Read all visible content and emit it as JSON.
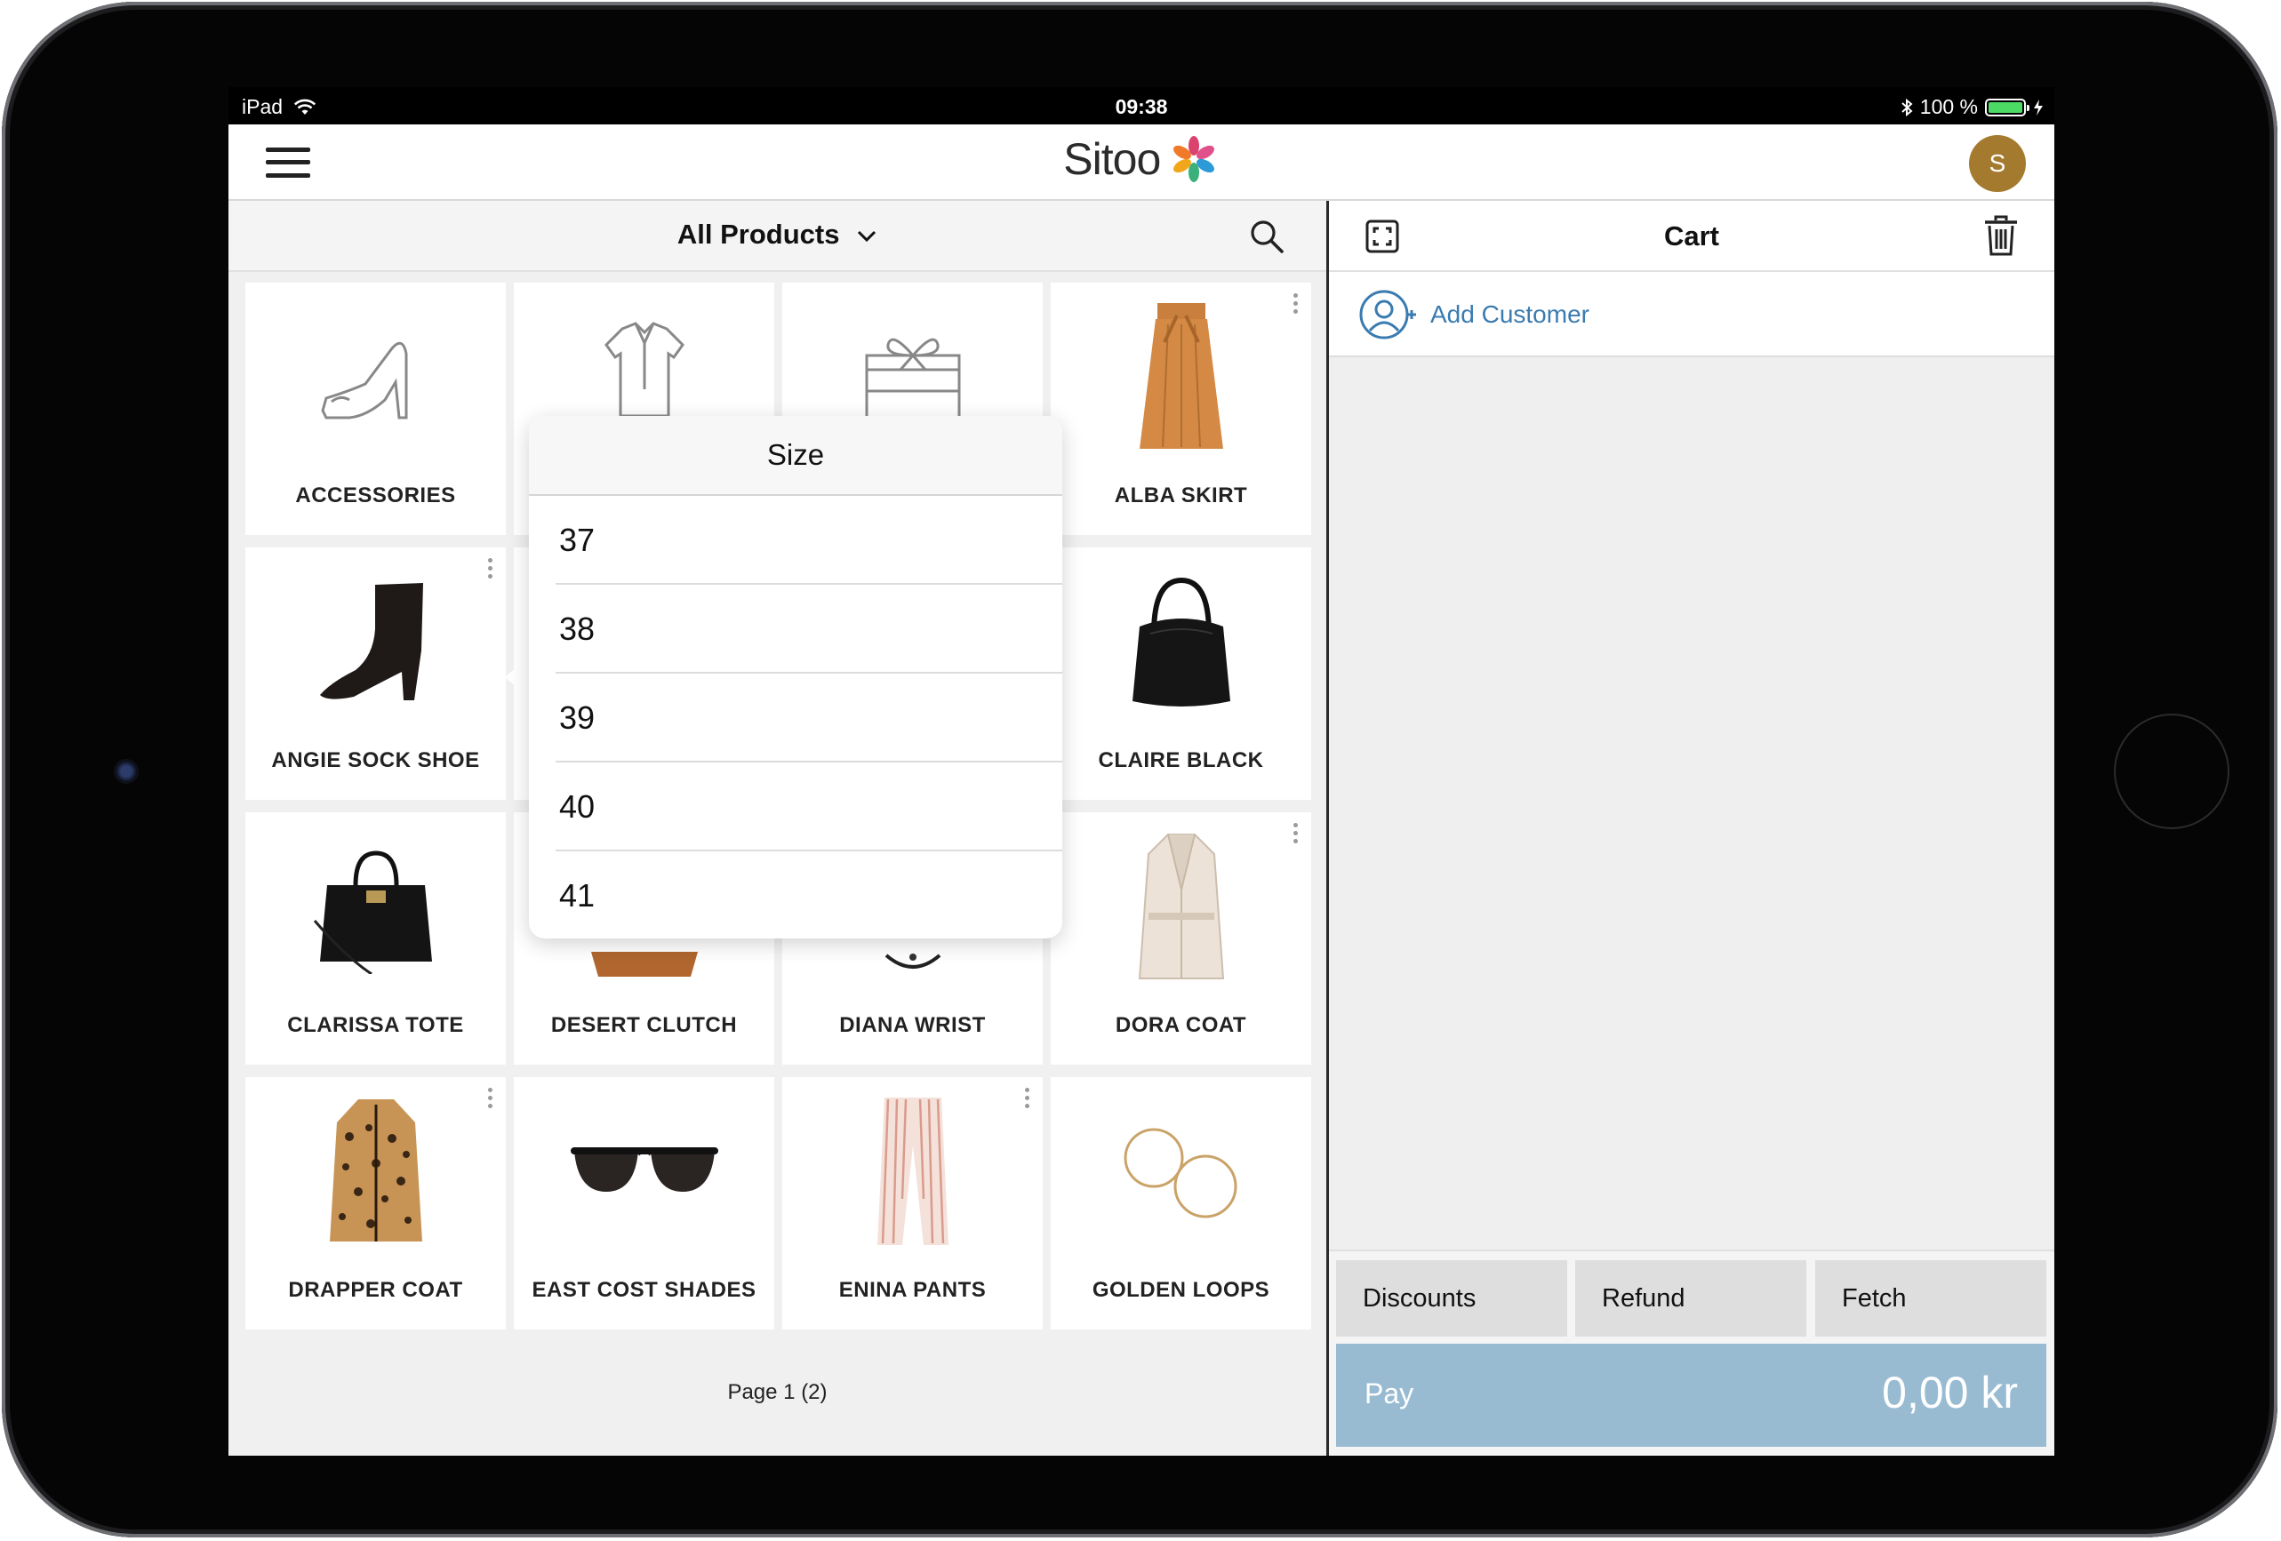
{
  "statusbar": {
    "device": "iPad",
    "time": "09:38",
    "battery": "100 %",
    "battery_level": 1.0
  },
  "topnav": {
    "logo_text": "Sitoo",
    "avatar_initial": "S",
    "avatar_color": "#a47a2f"
  },
  "products": {
    "category_label": "All Products",
    "tiles": [
      {
        "label": "ACCESSORIES",
        "icon": "shoe-icon"
      },
      {
        "label": "",
        "icon": "shirt-icon"
      },
      {
        "label": "",
        "icon": "gift-icon"
      },
      {
        "label": "ALBA SKIRT",
        "icon": "skirt-icon"
      },
      {
        "label": "ANGIE SOCK SHOE",
        "icon": "boot-icon"
      },
      {
        "label": "",
        "icon": ""
      },
      {
        "label": "",
        "icon": ""
      },
      {
        "label": "CLAIRE BLACK",
        "icon": "handbag-icon"
      },
      {
        "label": "CLARISSA TOTE",
        "icon": "tote-icon"
      },
      {
        "label": "DESERT CLUTCH",
        "icon": "clutch-icon"
      },
      {
        "label": "DIANA WRIST",
        "icon": "watch-icon"
      },
      {
        "label": "DORA COAT",
        "icon": "coat-icon"
      },
      {
        "label": "DRAPPER COAT",
        "icon": "leopard-coat-icon"
      },
      {
        "label": "EAST COST SHADES",
        "icon": "sunglasses-icon"
      },
      {
        "label": "ENINA PANTS",
        "icon": "pants-icon"
      },
      {
        "label": "GOLDEN LOOPS",
        "icon": "earrings-icon"
      }
    ],
    "page_indicator": "Page 1 (2)"
  },
  "size_popover": {
    "title": "Size",
    "options": [
      "37",
      "38",
      "39",
      "40",
      "41"
    ]
  },
  "cart": {
    "title": "Cart",
    "add_customer_label": "Add Customer",
    "actions": {
      "discounts": "Discounts",
      "refund": "Refund",
      "fetch": "Fetch"
    },
    "pay_label": "Pay",
    "pay_amount": "0,00 kr",
    "accent_color": "#3a7bb0",
    "pay_color": "#98bbd2"
  }
}
